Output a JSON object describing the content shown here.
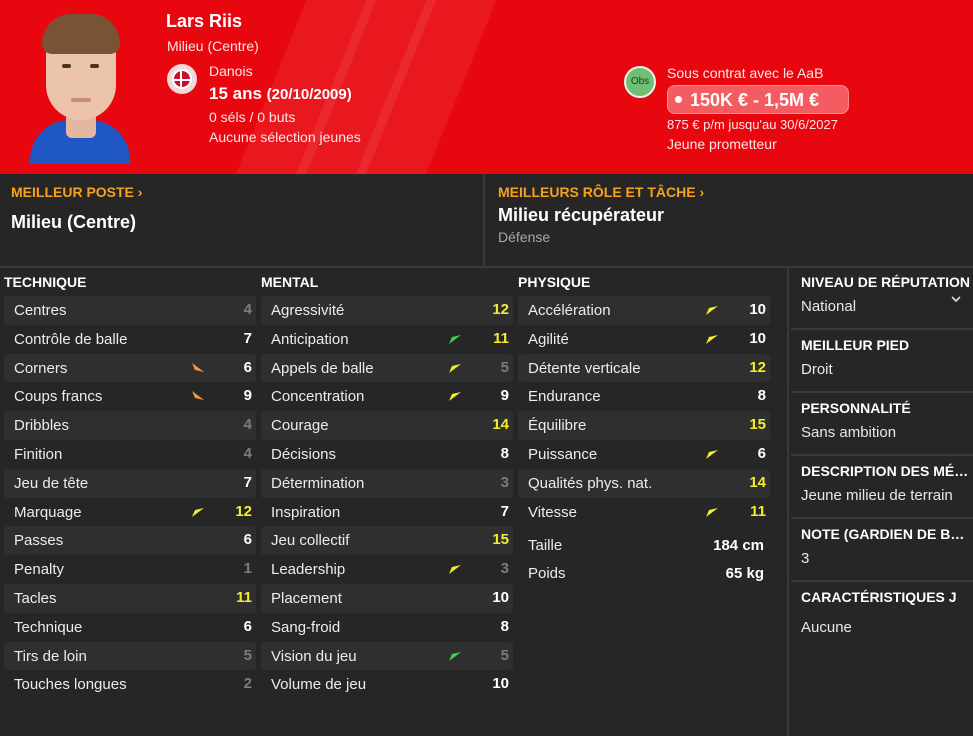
{
  "player": {
    "name": "Lars Riis",
    "position": "Milieu (Centre)",
    "nationality": "Danois",
    "age": "15 ans",
    "dob": "(20/10/2009)",
    "caps": "0 séls / 0 buts",
    "youth": "Aucune sélection jeunes"
  },
  "contract": {
    "club_badge": "Obs",
    "status": "Sous contrat avec le AaB",
    "value": "150K € - 1,5M €",
    "wage": "875 € p/m jusqu'au 30/6/2027",
    "tag": "Jeune prometteur"
  },
  "best": {
    "pos_title": "MEILLEUR POSTE",
    "pos_value": "Milieu (Centre)",
    "role_title": "MEILLEURS RÔLE ET TÂCHE",
    "role_value": "Milieu récupérateur",
    "role_duty": "Défense"
  },
  "columns": {
    "technique": "TECHNIQUE",
    "mental": "MENTAL",
    "physique": "PHYSIQUE"
  },
  "technique": [
    {
      "label": "Centres",
      "value": "4",
      "color": "grey"
    },
    {
      "label": "Contrôle de balle",
      "value": "7",
      "color": "white"
    },
    {
      "label": "Corners",
      "value": "6",
      "color": "white",
      "arrow": "down-orange"
    },
    {
      "label": "Coups francs",
      "value": "9",
      "color": "white",
      "arrow": "down-orange"
    },
    {
      "label": "Dribbles",
      "value": "4",
      "color": "grey"
    },
    {
      "label": "Finition",
      "value": "4",
      "color": "grey"
    },
    {
      "label": "Jeu de tête",
      "value": "7",
      "color": "white"
    },
    {
      "label": "Marquage",
      "value": "12",
      "color": "yellow",
      "arrow": "up-yellow"
    },
    {
      "label": "Passes",
      "value": "6",
      "color": "white"
    },
    {
      "label": "Penalty",
      "value": "1",
      "color": "grey"
    },
    {
      "label": "Tacles",
      "value": "11",
      "color": "yellow"
    },
    {
      "label": "Technique",
      "value": "6",
      "color": "white"
    },
    {
      "label": "Tirs de loin",
      "value": "5",
      "color": "grey"
    },
    {
      "label": "Touches longues",
      "value": "2",
      "color": "grey"
    }
  ],
  "mental": [
    {
      "label": "Agressivité",
      "value": "12",
      "color": "yellow"
    },
    {
      "label": "Anticipation",
      "value": "11",
      "color": "yellow",
      "arrow": "up-green"
    },
    {
      "label": "Appels de balle",
      "value": "5",
      "color": "grey",
      "arrow": "up-yellow"
    },
    {
      "label": "Concentration",
      "value": "9",
      "color": "white",
      "arrow": "up-yellow"
    },
    {
      "label": "Courage",
      "value": "14",
      "color": "yellow"
    },
    {
      "label": "Décisions",
      "value": "8",
      "color": "white"
    },
    {
      "label": "Détermination",
      "value": "3",
      "color": "grey"
    },
    {
      "label": "Inspiration",
      "value": "7",
      "color": "white"
    },
    {
      "label": "Jeu collectif",
      "value": "15",
      "color": "yellow"
    },
    {
      "label": "Leadership",
      "value": "3",
      "color": "grey",
      "arrow": "up-yellow"
    },
    {
      "label": "Placement",
      "value": "10",
      "color": "white"
    },
    {
      "label": "Sang-froid",
      "value": "8",
      "color": "white"
    },
    {
      "label": "Vision du jeu",
      "value": "5",
      "color": "grey",
      "arrow": "up-green"
    },
    {
      "label": "Volume de jeu",
      "value": "10",
      "color": "white"
    }
  ],
  "physique": [
    {
      "label": "Accélération",
      "value": "10",
      "color": "white",
      "arrow": "up-yellow"
    },
    {
      "label": "Agilité",
      "value": "10",
      "color": "white",
      "arrow": "up-yellow"
    },
    {
      "label": "Détente verticale",
      "value": "12",
      "color": "yellow"
    },
    {
      "label": "Endurance",
      "value": "8",
      "color": "white"
    },
    {
      "label": "Équilibre",
      "value": "15",
      "color": "yellow"
    },
    {
      "label": "Puissance",
      "value": "6",
      "color": "white",
      "arrow": "up-yellow"
    },
    {
      "label": "Qualités phys. nat.",
      "value": "14",
      "color": "yellow"
    },
    {
      "label": "Vitesse",
      "value": "11",
      "color": "yellow",
      "arrow": "up-yellow"
    }
  ],
  "physique_extra": [
    {
      "label": "Taille",
      "value": "184 cm"
    },
    {
      "label": "Poids",
      "value": "65 kg"
    }
  ],
  "side": [
    {
      "title": "NIVEAU DE RÉPUTATION",
      "value": "National"
    },
    {
      "title": "MEILLEUR PIED",
      "value": "Droit"
    },
    {
      "title": "PERSONNALITÉ",
      "value": "Sans ambition"
    },
    {
      "title": "DESCRIPTION DES MÉDIAS",
      "value": "Jeune milieu de terrain"
    },
    {
      "title": "NOTE (GARDIEN DE BUT)",
      "value": "3"
    },
    {
      "title": "CARACTÉRISTIQUES J",
      "value": "Aucune"
    }
  ],
  "colors": {
    "header_red": "#e8070f",
    "accent_orange": "#f4a21d",
    "attr_yellow": "#f5ec2e",
    "attr_grey": "#7d7d7d",
    "arrow_green": "#3fd34a",
    "arrow_orange": "#f39a3a"
  }
}
